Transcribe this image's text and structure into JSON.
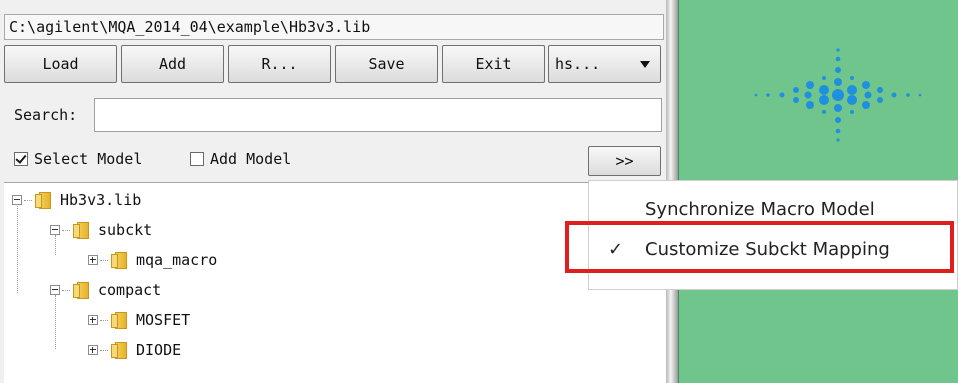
{
  "path": "C:\\agilent\\MQA_2014_04\\example\\Hb3v3.lib",
  "toolbar": {
    "load": "Load",
    "add": "Add",
    "r": "R...",
    "save": "Save",
    "exit": "Exit",
    "combo": "hs..."
  },
  "search": {
    "label": "Search:",
    "value": ""
  },
  "options": {
    "select_model": "Select Model",
    "add_model": "Add Model",
    "more": ">>"
  },
  "tree": {
    "root": "Hb3v3.lib",
    "subckt": "subckt",
    "mqa_macro": "mqa_macro",
    "compact": "compact",
    "mosfet": "MOSFET",
    "diode": "DIODE"
  },
  "menu": {
    "sync": "Synchronize Macro Model",
    "customize": "Customize Subckt Mapping",
    "check": "✓"
  },
  "colors": {
    "right_panel": "#6fc58b",
    "logo_blue": "#1f8fe0",
    "highlight": "#e01e1e"
  }
}
